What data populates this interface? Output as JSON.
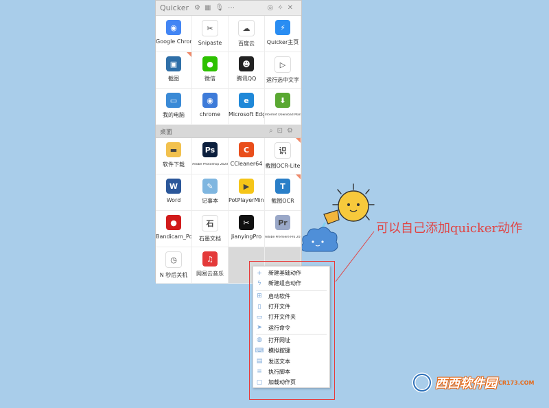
{
  "titlebar": {
    "title": "Quicker"
  },
  "top_grid": [
    {
      "label": "Google Chrome",
      "icon": "chrome-icon",
      "color": "#4285f4",
      "glyph": "◉",
      "tiny": false
    },
    {
      "label": "Snipaste",
      "icon": "snipaste-icon",
      "color": "#ffffff",
      "glyph": "✂",
      "tiny": false
    },
    {
      "label": "百度云",
      "icon": "baidu-cloud-icon",
      "color": "#ffffff",
      "glyph": "☁",
      "tiny": false
    },
    {
      "label": "Quicker主页",
      "icon": "quicker-icon",
      "color": "#2a8df2",
      "glyph": "⚡",
      "tiny": false
    },
    {
      "label": "截图",
      "icon": "screenshot-icon",
      "color": "#2f6fa8",
      "glyph": "▣",
      "tiny": false,
      "badge": true
    },
    {
      "label": "微信",
      "icon": "wechat-icon",
      "color": "#2dc100",
      "glyph": "●",
      "tiny": false
    },
    {
      "label": "腾讯QQ",
      "icon": "qq-icon",
      "color": "#222222",
      "glyph": "☻",
      "tiny": false
    },
    {
      "label": "运行选中文字",
      "icon": "run-text-icon",
      "color": "#ffffff",
      "glyph": "▷",
      "tiny": false
    },
    {
      "label": "我的电脑",
      "icon": "computer-icon",
      "color": "#3a8ad6",
      "glyph": "▭",
      "tiny": false
    },
    {
      "label": "chrome",
      "icon": "chrome-icon",
      "color": "#3d7bd9",
      "glyph": "◉",
      "tiny": false
    },
    {
      "label": "Microsoft Edge",
      "icon": "edge-icon",
      "color": "#1f88d8",
      "glyph": "e",
      "tiny": false
    },
    {
      "label": "Internet Download Manager",
      "icon": "idm-icon",
      "color": "#5aa832",
      "glyph": "⬇",
      "tiny": true
    }
  ],
  "section": {
    "title": "桌面"
  },
  "bottom_grid": [
    {
      "label": "软件下载",
      "icon": "folder-icon",
      "color": "#f2c14e",
      "glyph": "▬",
      "tiny": false
    },
    {
      "label": "Adobe Photoshop 2020",
      "icon": "photoshop-icon",
      "color": "#0c1f3d",
      "glyph": "Ps",
      "tiny": true
    },
    {
      "label": "CCleaner64",
      "icon": "ccleaner-icon",
      "color": "#e94e1b",
      "glyph": "C",
      "tiny": false
    },
    {
      "label": "截图OCR-Lite",
      "icon": "ocr-lite-icon",
      "color": "#ffffff",
      "glyph": "识",
      "tiny": false,
      "badge": true
    },
    {
      "label": "Word",
      "icon": "word-icon",
      "color": "#2b579a",
      "glyph": "W",
      "tiny": false
    },
    {
      "label": "记事本",
      "icon": "notepad-icon",
      "color": "#7fb6e0",
      "glyph": "✎",
      "tiny": false
    },
    {
      "label": "PotPlayerMini64",
      "icon": "potplayer-icon",
      "color": "#f5c518",
      "glyph": "▶",
      "tiny": false
    },
    {
      "label": "截图OCR",
      "icon": "ocr-icon",
      "color": "#2a7fc8",
      "glyph": "T",
      "tiny": false,
      "badge": true
    },
    {
      "label": "Bandicam_Portable",
      "icon": "bandicam-icon",
      "color": "#d11b1b",
      "glyph": "●",
      "tiny": false
    },
    {
      "label": "石墨文档",
      "icon": "shimo-icon",
      "color": "#ffffff",
      "glyph": "石",
      "tiny": false
    },
    {
      "label": "JianyingPro",
      "icon": "jianying-icon",
      "color": "#111111",
      "glyph": "✂",
      "tiny": false
    },
    {
      "label": "Adobe Premiere Pro 2020",
      "icon": "premiere-icon",
      "color": "#9aa8c8",
      "glyph": "Pr",
      "tiny": true
    },
    {
      "label": "N 秒后关机",
      "icon": "clock-icon",
      "color": "#ffffff",
      "glyph": "◷",
      "tiny": false
    },
    {
      "label": "网易云音乐",
      "icon": "netease-music-icon",
      "color": "#e43a3a",
      "glyph": "♫",
      "tiny": false
    },
    {
      "label": "",
      "icon": "",
      "color": "",
      "glyph": "",
      "tiny": false,
      "empty": true
    },
    {
      "label": "",
      "icon": "",
      "color": "",
      "glyph": "",
      "tiny": false,
      "empty": true
    }
  ],
  "context_menu": {
    "groups": [
      [
        {
          "label": "新建基础动作",
          "icon": "plus-icon",
          "glyph": "+"
        },
        {
          "label": "新建组合动作",
          "icon": "lightning-icon",
          "glyph": "ϟ"
        }
      ],
      [
        {
          "label": "启动软件",
          "icon": "windows-icon",
          "glyph": "⊞"
        },
        {
          "label": "打开文件",
          "icon": "file-icon",
          "glyph": "▯"
        },
        {
          "label": "打开文件夹",
          "icon": "folder-open-icon",
          "glyph": "▭"
        },
        {
          "label": "运行命令",
          "icon": "send-icon",
          "glyph": "➤"
        }
      ],
      [
        {
          "label": "打开网址",
          "icon": "globe-icon",
          "glyph": "◍"
        },
        {
          "label": "模拟按键",
          "icon": "keyboard-icon",
          "glyph": "⌨"
        },
        {
          "label": "发送文本",
          "icon": "message-icon",
          "glyph": "▤"
        },
        {
          "label": "执行脚本",
          "icon": "script-icon",
          "glyph": "≡"
        },
        {
          "label": "加载动作页",
          "icon": "page-icon",
          "glyph": "▢"
        }
      ]
    ]
  },
  "annotation": {
    "text": "可以自己添加quicker动作",
    "color": "#e04545"
  },
  "watermark": {
    "brand": "西西软件园",
    "domain": "CR173.COM"
  }
}
